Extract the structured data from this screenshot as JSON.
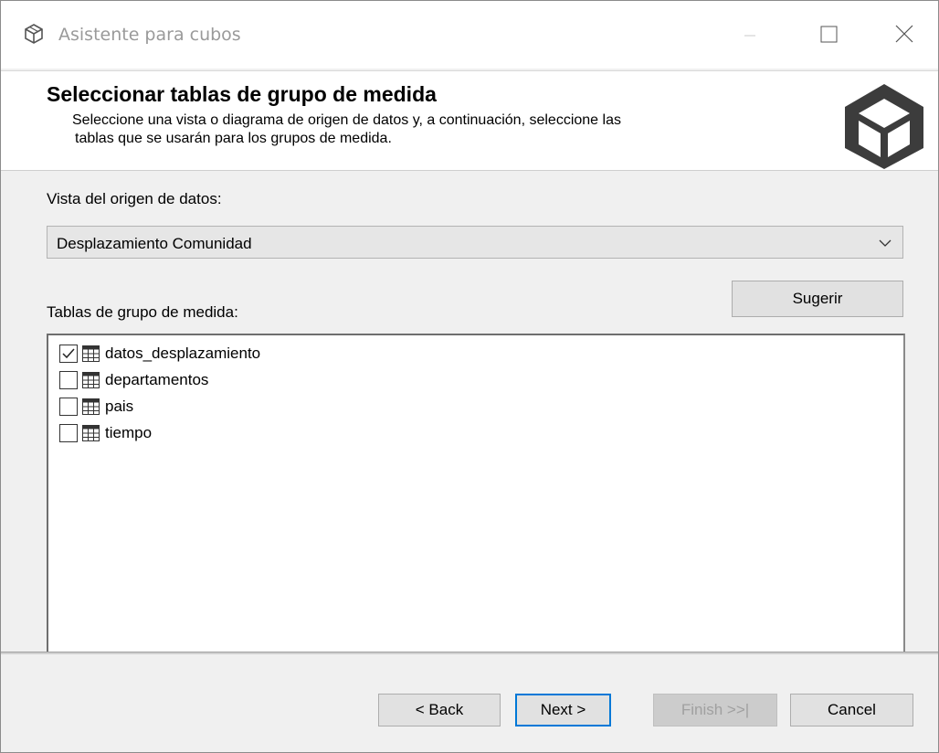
{
  "window": {
    "title": "Asistente para cubos",
    "controls": {
      "minimize_icon": "minimize-icon",
      "maximize_icon": "maximize-icon",
      "close_icon": "close-icon"
    }
  },
  "header": {
    "title": "Seleccionar tablas de grupo de medida",
    "description_line1": "Seleccione una vista o diagrama de origen de datos y, a continuación, seleccione las",
    "description_line2": "tablas que se usarán para los grupos de medida.",
    "icon": "cube-icon"
  },
  "data_source_view": {
    "label": "Vista del origen de datos:",
    "selected": "Desplazamiento Comunidad"
  },
  "tables": {
    "label": "Tablas de grupo de medida:",
    "suggest_label": "Sugerir",
    "items": [
      {
        "label": "datos_desplazamiento",
        "checked": true
      },
      {
        "label": "departamentos",
        "checked": false
      },
      {
        "label": "pais",
        "checked": false
      },
      {
        "label": "tiempo",
        "checked": false
      }
    ]
  },
  "footer": {
    "back_label": "< Back",
    "next_label": "Next >",
    "finish_label": "Finish >>|",
    "cancel_label": "Cancel"
  },
  "colors": {
    "accent": "#0078d7",
    "icon_dark": "#3c3c3c"
  }
}
